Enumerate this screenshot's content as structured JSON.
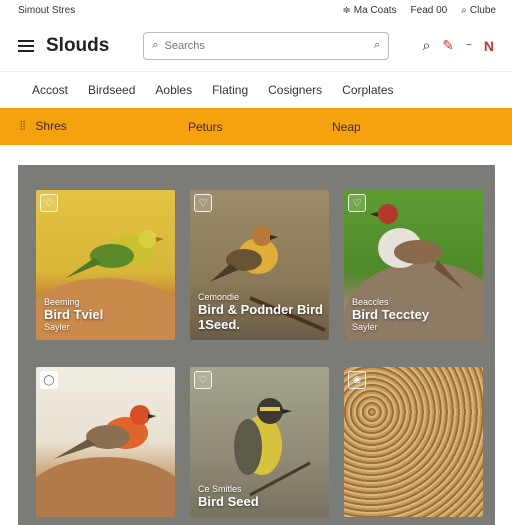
{
  "topbar": {
    "left": "Simout Stres",
    "links": [
      "Ma Coats",
      "Fead 00",
      "Clube"
    ]
  },
  "header": {
    "logo": "Slouds",
    "search_placeholder": "Searchs"
  },
  "nav": [
    "Accost",
    "Birdseed",
    "Aobles",
    "Flating",
    "Cosigners",
    "Corplates"
  ],
  "orange_bar": {
    "item1": "Shres",
    "item2": "Peturs",
    "item3": "Neap"
  },
  "cards": [
    {
      "cat": "Beeming",
      "title": "Bird Tviel",
      "sub": "Sayler"
    },
    {
      "cat": "Cemondie",
      "title": "Bird & Podnder Bird 1Seed.",
      "sub": ""
    },
    {
      "cat": "Beaccles",
      "title": "Bird Tecctey",
      "sub": "Sayler"
    },
    {
      "cat": "",
      "title": "",
      "sub": ""
    },
    {
      "cat": "Ce Smitles",
      "title": "Bird Seed",
      "sub": ""
    },
    {
      "cat": "",
      "title": "",
      "sub": ""
    }
  ]
}
